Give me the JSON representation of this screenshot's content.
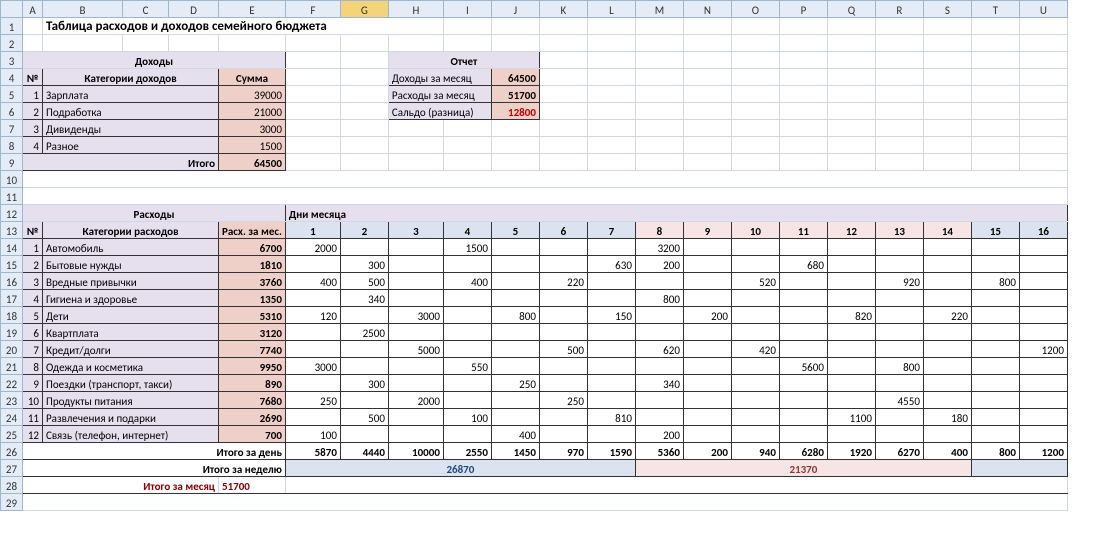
{
  "columns": [
    "A",
    "B",
    "C",
    "D",
    "E",
    "F",
    "G",
    "H",
    "I",
    "J",
    "K",
    "L",
    "M",
    "N",
    "O",
    "P",
    "Q",
    "R",
    "S",
    "T",
    "U"
  ],
  "title": "Таблица расходов и доходов семейного бюджета",
  "income": {
    "header": "Доходы",
    "num": "№",
    "cat": "Категории доходов",
    "sum": "Сумма",
    "rows": [
      {
        "n": "1",
        "name": "Зарплата",
        "val": "39000"
      },
      {
        "n": "2",
        "name": "Подработка",
        "val": "21000"
      },
      {
        "n": "3",
        "name": "Дивиденды",
        "val": "3000"
      },
      {
        "n": "4",
        "name": "Разное",
        "val": "1500"
      }
    ],
    "total_lbl": "Итого",
    "total": "64500"
  },
  "report": {
    "header": "Отчет",
    "r1": {
      "lbl": "Доходы за месяц",
      "val": "64500"
    },
    "r2": {
      "lbl": "Расходы за месяц",
      "val": "51700"
    },
    "r3": {
      "lbl": "Сальдо (разница)",
      "val": "12800"
    }
  },
  "expenses": {
    "header": "Расходы",
    "days_lbl": "Дни месяца",
    "num": "№",
    "cat": "Категории расходов",
    "permo": "Расх. за мес.",
    "days": [
      "1",
      "2",
      "3",
      "4",
      "5",
      "6",
      "7",
      "8",
      "9",
      "10",
      "11",
      "12",
      "13",
      "14",
      "15",
      "16"
    ],
    "rows": [
      {
        "n": "1",
        "name": "Автомобиль",
        "total": "6700",
        "d": [
          "2000",
          "",
          "",
          "1500",
          "",
          "",
          "",
          "3200",
          "",
          "",
          "",
          "",
          "",
          "",
          "",
          ""
        ]
      },
      {
        "n": "2",
        "name": "Бытовые нужды",
        "total": "1810",
        "d": [
          "",
          "300",
          "",
          "",
          "",
          "",
          "630",
          "200",
          "",
          "",
          "680",
          "",
          "",
          "",
          "",
          ""
        ]
      },
      {
        "n": "3",
        "name": "Вредные привычки",
        "total": "3760",
        "d": [
          "400",
          "500",
          "",
          "400",
          "",
          "220",
          "",
          "",
          "",
          "520",
          "",
          "",
          "920",
          "",
          "800",
          ""
        ]
      },
      {
        "n": "4",
        "name": "Гигиена и здоровье",
        "total": "1350",
        "d": [
          "",
          "340",
          "",
          "",
          "",
          "",
          "",
          "800",
          "",
          "",
          "",
          "",
          "",
          "",
          "",
          ""
        ]
      },
      {
        "n": "5",
        "name": "Дети",
        "total": "5310",
        "d": [
          "120",
          "",
          "3000",
          "",
          "800",
          "",
          "150",
          "",
          "200",
          "",
          "",
          "820",
          "",
          "220",
          "",
          ""
        ]
      },
      {
        "n": "6",
        "name": "Квартплата",
        "total": "3120",
        "d": [
          "",
          "2500",
          "",
          "",
          "",
          "",
          "",
          "",
          "",
          "",
          "",
          "",
          "",
          "",
          "",
          ""
        ]
      },
      {
        "n": "7",
        "name": "Кредит/долги",
        "total": "7740",
        "d": [
          "",
          "",
          "5000",
          "",
          "",
          "500",
          "",
          "620",
          "",
          "420",
          "",
          "",
          "",
          "",
          "",
          "1200"
        ]
      },
      {
        "n": "8",
        "name": "Одежда и косметика",
        "total": "9950",
        "d": [
          "3000",
          "",
          "",
          "550",
          "",
          "",
          "",
          "",
          "",
          "",
          "5600",
          "",
          "800",
          "",
          "",
          ""
        ]
      },
      {
        "n": "9",
        "name": "Поездки (транспорт, такси)",
        "total": "890",
        "d": [
          "",
          "300",
          "",
          "",
          "250",
          "",
          "",
          "340",
          "",
          "",
          "",
          "",
          "",
          "",
          "",
          ""
        ]
      },
      {
        "n": "10",
        "name": "Продукты питания",
        "total": "7680",
        "d": [
          "250",
          "",
          "2000",
          "",
          "",
          "250",
          "",
          "",
          "",
          "",
          "",
          "",
          "4550",
          "",
          "",
          ""
        ]
      },
      {
        "n": "11",
        "name": "Развлечения и подарки",
        "total": "2690",
        "d": [
          "",
          "500",
          "",
          "100",
          "",
          "",
          "810",
          "",
          "",
          "",
          "",
          "1100",
          "",
          "180",
          "",
          ""
        ]
      },
      {
        "n": "12",
        "name": "Связь (телефон, интернет)",
        "total": "700",
        "d": [
          "100",
          "",
          "",
          "",
          "400",
          "",
          "",
          "200",
          "",
          "",
          "",
          "",
          "",
          "",
          "",
          ""
        ]
      }
    ],
    "day_total_lbl": "Итого за день",
    "day_totals": [
      "5870",
      "4440",
      "10000",
      "2550",
      "1450",
      "970",
      "1590",
      "5360",
      "200",
      "940",
      "6280",
      "1920",
      "6270",
      "400",
      "800",
      "1200"
    ],
    "week_total_lbl": "Итого за неделю",
    "week1": "26870",
    "week2": "21370",
    "month_lbl": "Итого за месяц",
    "month_total": "51700"
  }
}
